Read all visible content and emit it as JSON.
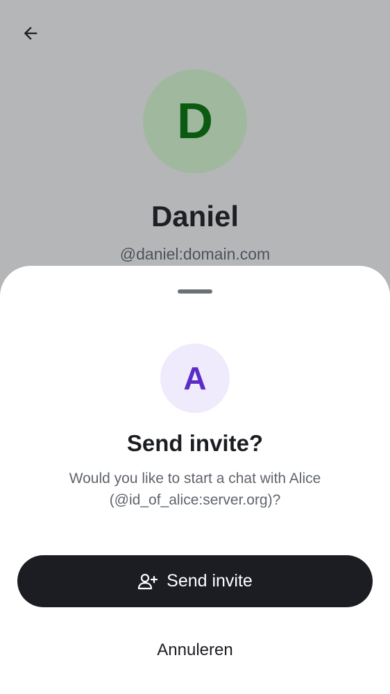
{
  "profile": {
    "avatar_initial": "D",
    "name": "Daniel",
    "user_id": "@daniel:domain.com"
  },
  "sheet": {
    "avatar_initial": "A",
    "title": "Send invite?",
    "message": "Would you like to start a chat with Alice (@id_of_alice:server.org)?",
    "send_button_label": "Send invite",
    "cancel_button_label": "Annuleren"
  },
  "icons": {
    "back": "arrow-left-icon",
    "send": "person-add-icon"
  },
  "colors": {
    "scrim_background": "#b5b6b8",
    "profile_avatar_bg": "#9fb89e",
    "profile_avatar_fg": "#0b5a12",
    "invitee_avatar_bg": "#efeafc",
    "invitee_avatar_fg": "#5b2cc8",
    "primary_button_bg": "#1b1d22"
  }
}
